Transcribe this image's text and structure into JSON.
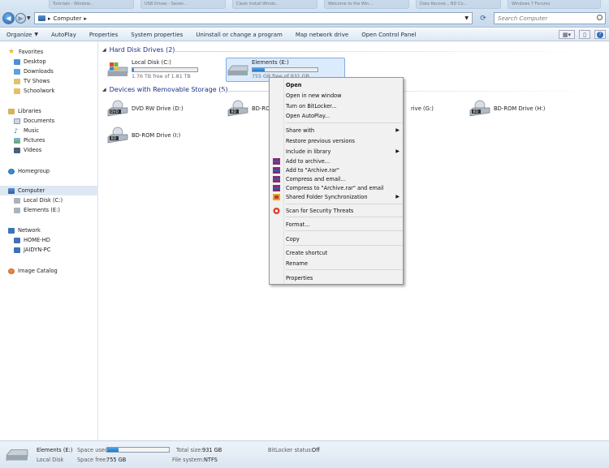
{
  "background_tabs": [
    "Tutorials - Window...",
    "USB Drives - Seven...",
    "Clean Install Windo...",
    "Welcome to the Win...",
    "Data Recove... BD Co...",
    "Windows 7 Forums"
  ],
  "address": {
    "root_icon": "computer-icon",
    "path": "Computer",
    "separator": "▸"
  },
  "search": {
    "placeholder": "Search Computer"
  },
  "command_bar": {
    "organize": "Organize",
    "autoplay": "AutoPlay",
    "properties": "Properties",
    "system_properties": "System properties",
    "uninstall": "Uninstall or change a program",
    "map_drive": "Map network drive",
    "control_panel": "Open Control Panel"
  },
  "nav": {
    "favorites": "Favorites",
    "fav_items": [
      "Desktop",
      "Downloads",
      "TV Shows",
      "Schoolwork"
    ],
    "libraries": "Libraries",
    "lib_items": [
      "Documents",
      "Music",
      "Pictures",
      "Videos"
    ],
    "homegroup": "Homegroup",
    "computer": "Computer",
    "comp_items": [
      "Local Disk (C:)",
      "Elements (E:)"
    ],
    "network": "Network",
    "net_items": [
      "HOME-HD",
      "JAIDYN-PC"
    ],
    "image_catalog": "Image Catalog"
  },
  "hard_disk_group": "Hard Disk Drives (2)",
  "drives": [
    {
      "name": "Local Disk (C:)",
      "free": "1.76 TB free of 1.81 TB",
      "fill": 0.03
    },
    {
      "name": "Elements (E:)",
      "free": "755 GB free of 931 GB",
      "fill": 0.19
    }
  ],
  "removable_group": "Devices with Removable Storage (5)",
  "removable": [
    "DVD RW Drive (D:)",
    "BD-RO",
    "rive (G:)",
    "BD-ROM Drive (H:)",
    "BD-ROM Drive (I:)"
  ],
  "context_menu": {
    "open": "Open",
    "open_new": "Open in new window",
    "bitlocker": "Turn on BitLocker...",
    "autoplay": "Open AutoPlay...",
    "share": "Share with",
    "restore": "Restore previous versions",
    "include": "Include in library",
    "add_archive": "Add to archive...",
    "add_rar": "Add to \"Archive.rar\"",
    "compress_email": "Compress and email...",
    "compress_rar_email": "Compress to \"Archive.rar\" and email",
    "shared_sync": "Shared Folder Synchronization",
    "scan": "Scan for Security Threats",
    "format": "Format...",
    "copy": "Copy",
    "shortcut": "Create shortcut",
    "rename": "Rename",
    "properties": "Properties"
  },
  "status": {
    "name": "Elements (E:)",
    "type": "Local Disk",
    "space_used_label": "Space used:",
    "space_free_label": "Space free:",
    "space_free": "755 GB",
    "total_label": "Total size:",
    "total": "931 GB",
    "fs_label": "File system:",
    "fs": "NTFS",
    "bitlocker_label": "BitLocker status:",
    "bitlocker": "Off",
    "used_fraction": 0.19
  },
  "colors": {
    "accent": "#1e78c7",
    "group_title": "#1e3287",
    "selection": "#dcebfc"
  }
}
